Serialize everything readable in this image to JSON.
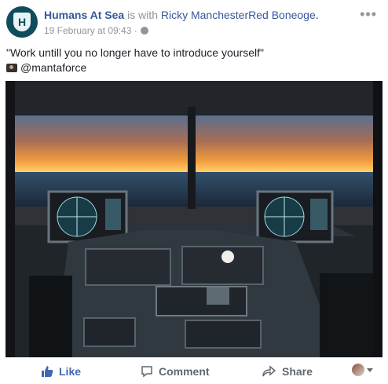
{
  "post": {
    "page_name": "Humans At Sea",
    "with_text": "is with",
    "tagged_person": "Ricky ManchesterRed Boneoge",
    "period": ".",
    "timestamp": "19 February at 09:43 ·",
    "quote": "\"Work untill you no longer have to introduce yourself\"",
    "credit": "@mantaforce",
    "more_label": "•••"
  },
  "actions": {
    "like": "Like",
    "comment": "Comment",
    "share": "Share"
  },
  "colors": {
    "link": "#365899",
    "like": "#4267b2",
    "muted": "#90949c"
  },
  "icons": {
    "avatar": "shield-h-logo-icon",
    "audience": "globe-icon",
    "like": "thumbs-up-icon",
    "comment": "speech-bubble-icon",
    "share": "share-arrow-icon",
    "camera": "camera-emoji-icon",
    "more": "ellipsis-icon",
    "caret": "chevron-down-icon"
  },
  "avatar_letter": "H"
}
